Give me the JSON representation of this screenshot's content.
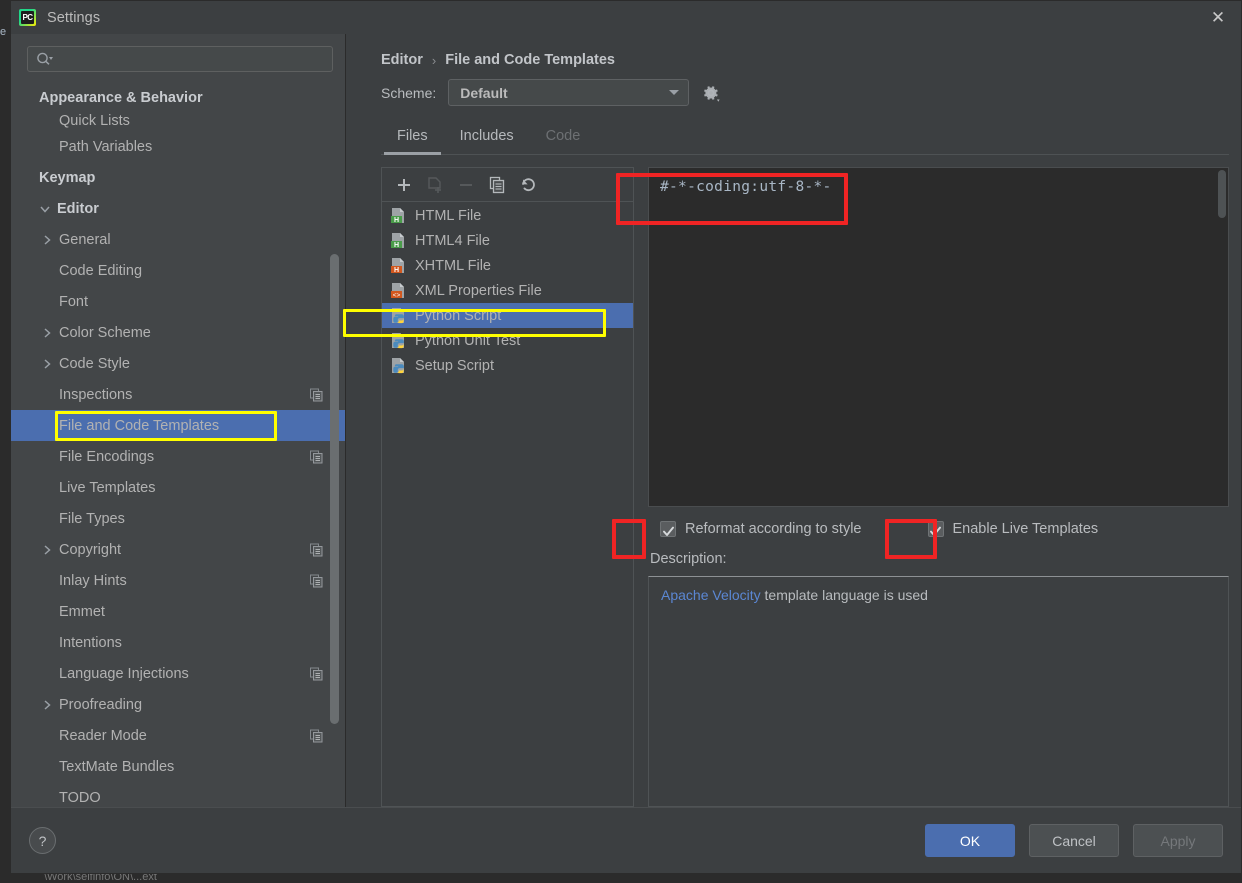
{
  "background": {
    "left_edge_text": "e",
    "bottom_text": "\\Work\\selfinfo\\ON\\...ext"
  },
  "window": {
    "title": "Settings",
    "app_icon": "pycharm-icon",
    "close_icon": "close-icon"
  },
  "sidebar": {
    "search": {
      "placeholder": "",
      "value": "",
      "icon": "search-icon"
    },
    "items": [
      {
        "label": "Appearance & Behavior",
        "type": "group",
        "arrow": "",
        "badge": false,
        "selected": false
      },
      {
        "label": "Quick Lists",
        "type": "child",
        "arrow": "",
        "badge": false,
        "selected": false,
        "clipped": true
      },
      {
        "label": "Path Variables",
        "type": "child",
        "arrow": "",
        "badge": false,
        "selected": false
      },
      {
        "label": "Keymap",
        "type": "group",
        "arrow": "",
        "badge": false,
        "selected": false
      },
      {
        "label": "Editor",
        "type": "group",
        "arrow": "v",
        "badge": false,
        "selected": false
      },
      {
        "label": "General",
        "type": "child-arrow",
        "arrow": ">",
        "badge": false,
        "selected": false
      },
      {
        "label": "Code Editing",
        "type": "child",
        "arrow": "",
        "badge": false,
        "selected": false
      },
      {
        "label": "Font",
        "type": "child",
        "arrow": "",
        "badge": false,
        "selected": false
      },
      {
        "label": "Color Scheme",
        "type": "child-arrow",
        "arrow": ">",
        "badge": false,
        "selected": false
      },
      {
        "label": "Code Style",
        "type": "child-arrow",
        "arrow": ">",
        "badge": false,
        "selected": false
      },
      {
        "label": "Inspections",
        "type": "child",
        "arrow": "",
        "badge": true,
        "selected": false
      },
      {
        "label": "File and Code Templates",
        "type": "child",
        "arrow": "",
        "badge": false,
        "selected": true
      },
      {
        "label": "File Encodings",
        "type": "child",
        "arrow": "",
        "badge": true,
        "selected": false
      },
      {
        "label": "Live Templates",
        "type": "child",
        "arrow": "",
        "badge": false,
        "selected": false
      },
      {
        "label": "File Types",
        "type": "child",
        "arrow": "",
        "badge": false,
        "selected": false
      },
      {
        "label": "Copyright",
        "type": "child-arrow",
        "arrow": ">",
        "badge": true,
        "selected": false
      },
      {
        "label": "Inlay Hints",
        "type": "child",
        "arrow": "",
        "badge": true,
        "selected": false
      },
      {
        "label": "Emmet",
        "type": "child",
        "arrow": "",
        "badge": false,
        "selected": false
      },
      {
        "label": "Intentions",
        "type": "child",
        "arrow": "",
        "badge": false,
        "selected": false
      },
      {
        "label": "Language Injections",
        "type": "child",
        "arrow": "",
        "badge": true,
        "selected": false
      },
      {
        "label": "Proofreading",
        "type": "child-arrow",
        "arrow": ">",
        "badge": false,
        "selected": false
      },
      {
        "label": "Reader Mode",
        "type": "child",
        "arrow": "",
        "badge": true,
        "selected": false
      },
      {
        "label": "TextMate Bundles",
        "type": "child",
        "arrow": "",
        "badge": false,
        "selected": false
      },
      {
        "label": "TODO",
        "type": "child",
        "arrow": "",
        "badge": false,
        "selected": false
      }
    ]
  },
  "main": {
    "breadcrumb": {
      "parent": "Editor",
      "separator": "›",
      "current": "File and Code Templates"
    },
    "scheme": {
      "label": "Scheme:",
      "value": "Default",
      "gear_icon": "gear-icon"
    },
    "tabs": [
      {
        "label": "Files",
        "state": "active"
      },
      {
        "label": "Includes",
        "state": "normal"
      },
      {
        "label": "Code",
        "state": "disabled"
      }
    ],
    "template_toolbar": [
      {
        "icon": "add-icon",
        "state": "enabled"
      },
      {
        "icon": "create-from-file-icon",
        "state": "disabled"
      },
      {
        "icon": "remove-icon",
        "state": "disabled"
      },
      {
        "icon": "copy-icon",
        "state": "enabled"
      },
      {
        "icon": "revert-icon",
        "state": "enabled"
      }
    ],
    "templates": [
      {
        "label": "HTML File",
        "icon": "html-file-icon",
        "selected": false
      },
      {
        "label": "HTML4 File",
        "icon": "html-file-icon",
        "selected": false
      },
      {
        "label": "XHTML File",
        "icon": "xhtml-file-icon",
        "selected": false
      },
      {
        "label": "XML Properties File",
        "icon": "xml-file-icon",
        "selected": false
      },
      {
        "label": "Python Script",
        "icon": "python-file-icon",
        "selected": true
      },
      {
        "label": "Python Unit Test",
        "icon": "python-file-icon",
        "selected": false
      },
      {
        "label": "Setup Script",
        "icon": "python-file-icon",
        "selected": false
      }
    ],
    "editor": {
      "content": "#-*-coding:utf-8-*-"
    },
    "checkboxes": [
      {
        "label": "Reformat according to style",
        "checked": true
      },
      {
        "label": "Enable Live Templates",
        "checked": true
      }
    ],
    "description": {
      "label": "Description:",
      "link_text": "Apache Velocity",
      "rest_text": " template language is used"
    }
  },
  "footer": {
    "help_label": "?",
    "buttons": [
      {
        "label": "OK",
        "style": "primary"
      },
      {
        "label": "Cancel",
        "style": "normal"
      },
      {
        "label": "Apply",
        "style": "disabled"
      }
    ]
  },
  "colors": {
    "selection_blue": "#4b6eaf",
    "annotation_yellow": "#ffff00",
    "annotation_red": "#f02424",
    "link_blue": "#5b87d3",
    "panel_bg": "#3c3f41",
    "sidebar_bg": "#434648",
    "editor_bg": "#2b2b2b"
  }
}
